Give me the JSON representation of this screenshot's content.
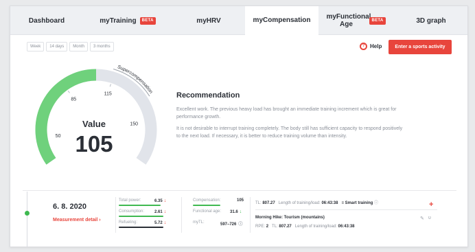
{
  "tabs": [
    {
      "label": "Dashboard",
      "beta": ""
    },
    {
      "label": "myTraining",
      "beta": "BETA"
    },
    {
      "label": "myHRV",
      "beta": ""
    },
    {
      "label": "myCompensation",
      "beta": ""
    },
    {
      "label": "myFunctional Age",
      "beta": "BETA"
    },
    {
      "label": "3D graph",
      "beta": ""
    }
  ],
  "periods": [
    "Week",
    "14 days",
    "Month",
    "3 months"
  ],
  "help_label": "Help",
  "enter_activity_label": "Enter a sports activity",
  "gauge": {
    "value_label": "Value",
    "value": "105",
    "ticks": [
      "50",
      "85",
      "115",
      "150"
    ],
    "zone_label": "Supercompensation",
    "min": 35,
    "max": 175,
    "zone_start": 115,
    "color_fill": "#6fd17c",
    "color_track": "#e1e4ea"
  },
  "recommendation": {
    "title": "Recommendation",
    "paragraph1": "Excellent work. The previous heavy load has brought an immediate training increment which is great for performance growth.",
    "paragraph2": "It is not desirable to interrupt training completely. The body still has sufficient capacity to respond positively to the next load. If necessary, it is better to reduce training volume than intensity."
  },
  "summary": {
    "date": "6. 8. 2020",
    "detail_link": "Measurement detail ›"
  },
  "metrics_left": [
    {
      "label": "Total power:",
      "value": "6.35",
      "arrow": "↓",
      "arrow_color": "#e8453c",
      "bar_color": "#3fb950",
      "bar_level": 0.9
    },
    {
      "label": "Consumption:",
      "value": "2.61",
      "arrow": "↓",
      "arrow_color": "#e8453c",
      "bar_color": "#3fb950",
      "bar_level": 0.95
    },
    {
      "label": "Refueling:",
      "value": "5.72",
      "arrow": "↓",
      "arrow_color": "#e8453c",
      "bar_color": "#2b2f36",
      "bar_level": 0.95
    }
  ],
  "metrics_right": [
    {
      "label": "Compensation:",
      "value": "105",
      "arrow": "",
      "arrow_color": "#3fb950",
      "bar_color": "#3fb950",
      "bar_level": 0.55
    },
    {
      "label": "Functional age:",
      "value": "31.6",
      "arrow": "↓",
      "arrow_color": "#3fb950",
      "bar_color": "",
      "bar_level": 0
    },
    {
      "label": "myTL:",
      "value": "597–726",
      "arrow": "",
      "arrow_color": "",
      "bar_color": "",
      "bar_level": 0,
      "info": "ⓘ"
    }
  ],
  "activity": {
    "tl_label": "TL:",
    "tl_value": "807.27",
    "length_label": "Length of training/load:",
    "length_value": "06:43:38",
    "smart_label": "≡ Smart training",
    "smart_info": "ⓘ",
    "title": "Morning Hike: Tourism (mountains)",
    "rpe_label": "RPE:",
    "rpe_value": "2",
    "tl2_label": "TL:",
    "tl2_value": "807.27",
    "length2_label": "Length of training/load:",
    "length2_value": "06:43:38",
    "plus": "+",
    "edit_icon": "✎",
    "delete_icon": "ᴜ"
  }
}
